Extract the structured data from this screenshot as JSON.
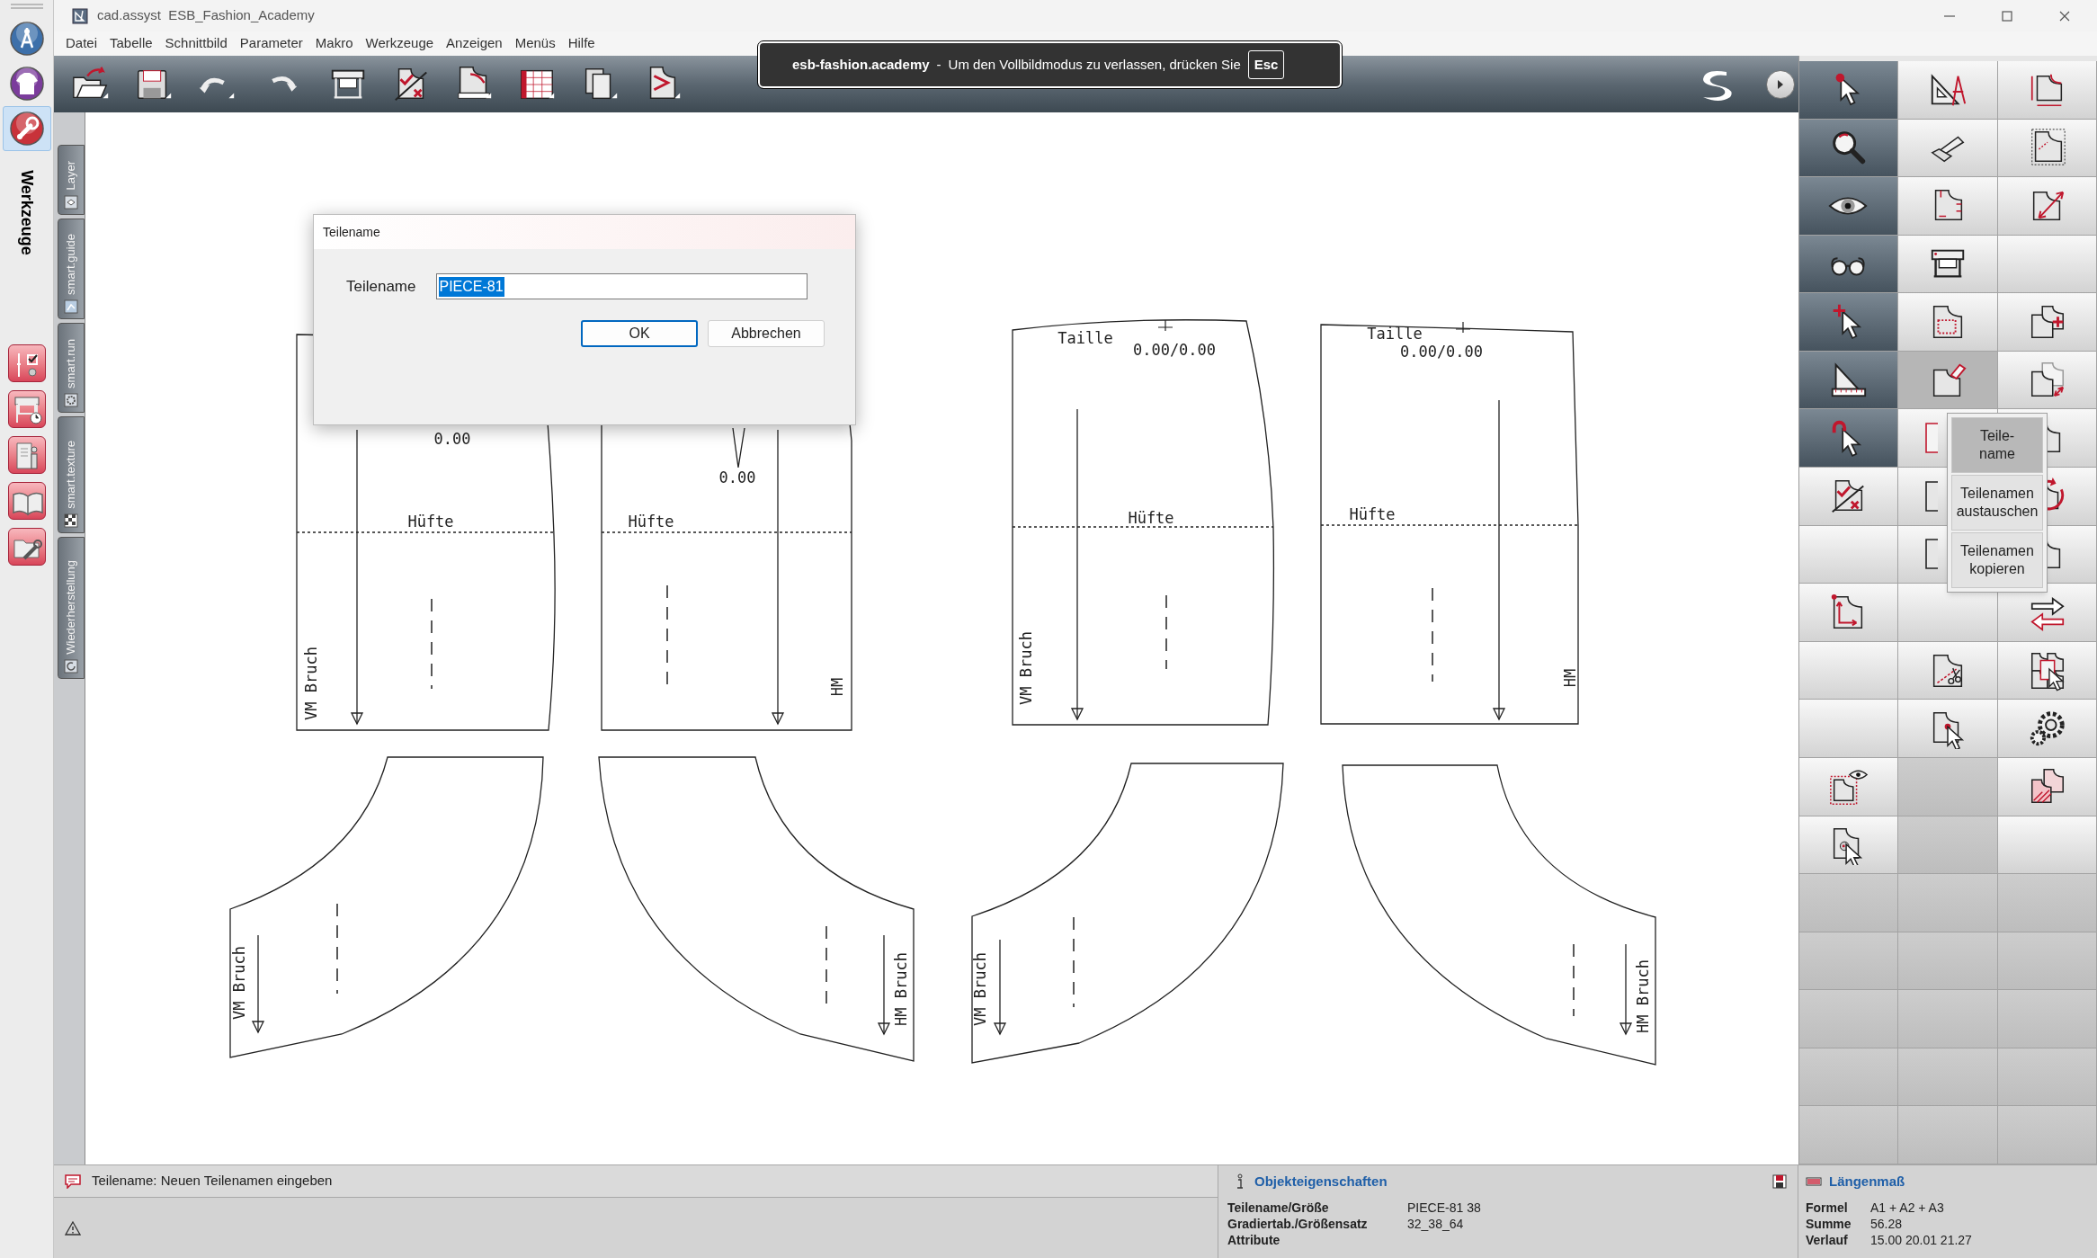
{
  "window": {
    "title": "cad.assyst  ESB_Fashion_Academy"
  },
  "menu": [
    "Datei",
    "Tabelle",
    "Schnittbild",
    "Parameter",
    "Makro",
    "Werkzeuge",
    "Anzeigen",
    "Menüs",
    "Hilfe"
  ],
  "fullscreen_notice": {
    "site": "esb-fashion.academy",
    "separator": "-",
    "message": "Um den Vollbildmodus zu verlassen, drücken Sie",
    "key": "Esc"
  },
  "left_sidebar": {
    "modes": [
      {
        "selected": false
      },
      {
        "selected": false
      },
      {
        "selected": true
      }
    ],
    "title": "Werkzeuge"
  },
  "side_tabs": [
    "Layer",
    "smart.guide",
    "smart.run",
    "smart.texture",
    "Wiederherstellung"
  ],
  "dialog": {
    "title": "Teilename",
    "label": "Teilename",
    "value": "PIECE-81",
    "value_selected": true,
    "buttons": [
      {
        "label": "OK",
        "focused": true
      },
      {
        "label": "Abbrechen",
        "focused": false
      }
    ]
  },
  "pattern_pieces": [
    {
      "measure": "0.00",
      "hip_label": "Hüfte",
      "grain_label": "VM Bruch"
    },
    {
      "measure": "0.00",
      "hip_label": "Hüfte",
      "grain_label": "HM"
    },
    {
      "waist_label": "Taille",
      "measure": "0.00/0.00",
      "hip_label": "Hüfte",
      "grain_label": "VM Bruch"
    },
    {
      "waist_label": "Taille",
      "measure": "0.00/0.00",
      "hip_label": "Hüfte",
      "grain_label": "HM"
    },
    {
      "grain_label": "VM Bruch"
    },
    {
      "grain_label": "HM Bruch"
    },
    {
      "grain_label": "VM Bruch"
    },
    {
      "grain_label": "HM Bruch"
    }
  ],
  "tool_palette": {
    "rows": [
      [
        {
          "kind": "tool",
          "selected": false
        },
        {
          "kind": "tool",
          "selected": false
        },
        {
          "kind": "tool",
          "selected": false
        }
      ],
      [
        {
          "kind": "tool",
          "selected": false
        },
        {
          "kind": "tool",
          "selected": false
        },
        {
          "kind": "tool",
          "selected": false
        }
      ],
      [
        {
          "kind": "tool",
          "selected": false
        },
        {
          "kind": "tool",
          "selected": false
        },
        {
          "kind": "tool",
          "selected": false
        }
      ],
      [
        {
          "kind": "tool",
          "selected": false
        },
        {
          "kind": "tool",
          "selected": false
        },
        {
          "kind": "empty"
        }
      ],
      [
        {
          "kind": "tool",
          "selected": false
        },
        {
          "kind": "tool",
          "selected": false
        },
        {
          "kind": "tool",
          "selected": false
        }
      ],
      [
        {
          "kind": "tool",
          "selected": false
        },
        {
          "kind": "tool",
          "selected": true
        },
        {
          "kind": "tool",
          "selected": false
        }
      ],
      [
        {
          "kind": "tool",
          "selected": false
        },
        {
          "kind": "tool",
          "selected": false
        },
        {
          "kind": "tool",
          "selected": false
        }
      ],
      [
        {
          "kind": "tool",
          "selected": false
        },
        {
          "kind": "tool",
          "selected": false
        },
        {
          "kind": "tool",
          "selected": false
        }
      ],
      [
        {
          "kind": "empty"
        },
        {
          "kind": "tool",
          "selected": false
        },
        {
          "kind": "tool",
          "selected": false
        }
      ],
      [
        {
          "kind": "tool",
          "selected": false
        },
        {
          "kind": "empty"
        },
        {
          "kind": "tool",
          "selected": false
        }
      ],
      [
        {
          "kind": "empty"
        },
        {
          "kind": "tool",
          "selected": false
        },
        {
          "kind": "tool",
          "selected": false
        }
      ],
      [
        {
          "kind": "empty"
        },
        {
          "kind": "tool",
          "selected": false
        },
        {
          "kind": "tool",
          "selected": false
        }
      ],
      [
        {
          "kind": "tool",
          "selected": false
        },
        {
          "kind": "empty"
        },
        {
          "kind": "tool",
          "selected": false
        }
      ],
      [
        {
          "kind": "tool",
          "selected": false
        },
        {
          "kind": "empty"
        },
        {
          "kind": "empty"
        }
      ]
    ]
  },
  "popup_menu": [
    {
      "label": "Teile-\nname",
      "selected": true
    },
    {
      "label": "Teilenamen austauschen",
      "selected": false
    },
    {
      "label": "Teilenamen kopieren",
      "selected": false
    }
  ],
  "status_bar": {
    "hint": "Teilename: Neuen Teilenamen eingeben",
    "properties": {
      "title": "Objekteigenschaften",
      "rows": [
        {
          "label": "Teilename/Größe",
          "value": "PIECE-81 38"
        },
        {
          "label": "Gradiertab./Größensatz",
          "value": "32_38_64"
        },
        {
          "label": "Attribute"
        }
      ]
    },
    "measure": {
      "title": "Längenmaß",
      "rows": [
        {
          "label": "Formel",
          "value": "A1 + A2 + A3"
        },
        {
          "label": "Summe",
          "value": "56.28"
        },
        {
          "label": "Verlauf",
          "value": "15.00 20.01 21.27"
        }
      ]
    }
  }
}
